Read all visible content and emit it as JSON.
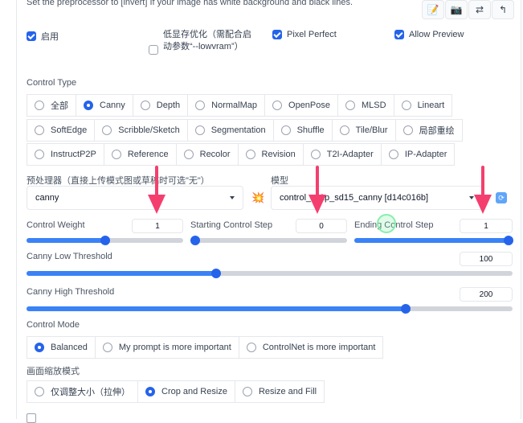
{
  "hint_text": "Set the preprocessor to [invert] If your image has white background and black lines.",
  "toolbar": {
    "icons": [
      "edit-icon",
      "camera-icon",
      "swap-icon",
      "send-up-icon"
    ],
    "glyphs": [
      "📝",
      "📷",
      "⇄",
      "↰"
    ]
  },
  "options": {
    "enable": "启用",
    "low_vram": "低显存优化（需配合启动参数“--lowvram”）",
    "pixel_perfect": "Pixel Perfect",
    "allow_preview": "Allow Preview"
  },
  "control_type": {
    "label": "Control Type",
    "selected": "Canny",
    "row1": [
      "全部",
      "Canny",
      "Depth",
      "NormalMap",
      "OpenPose",
      "MLSD",
      "Lineart"
    ],
    "row2": [
      "SoftEdge",
      "Scribble/Sketch",
      "Segmentation",
      "Shuffle",
      "Tile/Blur",
      "局部重绘"
    ],
    "row3": [
      "InstructP2P",
      "Reference",
      "Recolor",
      "Revision",
      "T2I-Adapter",
      "IP-Adapter"
    ]
  },
  "preprocessor": {
    "label": "预处理器（直接上传模式图或草稿时可选\"无\"）",
    "value": "canny",
    "run_icon": "💥"
  },
  "model": {
    "label": "模型",
    "value": "control_v11p_sd15_canny [d14c016b]",
    "refresh_icon": "🔄"
  },
  "sliders": {
    "control_weight": {
      "label": "Control Weight",
      "value": "1",
      "fraction": 0.5
    },
    "starting_step": {
      "label": "Starting Control Step",
      "value": "0",
      "fraction": 0.0
    },
    "ending_step": {
      "label": "Ending Control Step",
      "value": "1",
      "fraction": 1.0
    },
    "low_threshold": {
      "label": "Canny Low Threshold",
      "value": "100",
      "fraction": 0.39
    },
    "high_threshold": {
      "label": "Canny High Threshold",
      "value": "200",
      "fraction": 0.78
    }
  },
  "control_mode": {
    "label": "Control Mode",
    "options": [
      "Balanced",
      "My prompt is more important",
      "ControlNet is more important"
    ],
    "selected": "Balanced"
  },
  "resize_mode": {
    "label": "画面缩放模式",
    "options": [
      "仅调整大小（拉伸）",
      "Crop and Resize",
      "Resize and Fill"
    ],
    "selected": "Crop and Resize"
  },
  "colors": {
    "accent": "#2563eb",
    "arrow": "#f43f6e"
  }
}
